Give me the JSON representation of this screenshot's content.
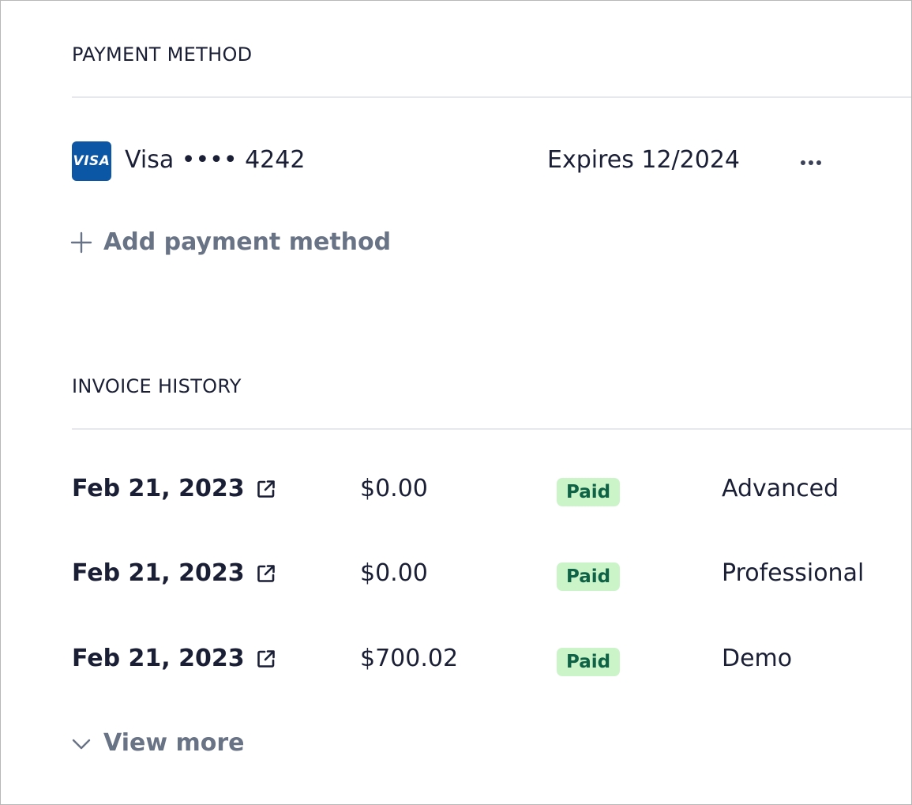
{
  "payment_method": {
    "title": "PAYMENT METHOD",
    "card": {
      "brand_logo_text": "VISA",
      "label": "Visa •••• 4242",
      "expiry": "Expires 12/2024",
      "brand_color": "#0b56a5"
    },
    "more_icon": "more-horizontal-icon",
    "add_label": "Add payment method",
    "add_icon": "plus-icon"
  },
  "invoice_history": {
    "title": "INVOICE HISTORY",
    "rows": [
      {
        "date": "Feb 21, 2023",
        "amount": "$0.00",
        "status": "Paid",
        "plan": "Advanced"
      },
      {
        "date": "Feb 21, 2023",
        "amount": "$0.00",
        "status": "Paid",
        "plan": "Professional"
      },
      {
        "date": "Feb 21, 2023",
        "amount": "$700.02",
        "status": "Paid",
        "plan": "Demo"
      }
    ],
    "link_icon": "external-link-icon",
    "view_more_label": "View more",
    "view_more_icon": "chevron-down-icon"
  },
  "colors": {
    "text_primary": "#1a1f36",
    "text_muted": "#697386",
    "divider": "#e6e8eb",
    "status_paid_bg": "#cbf4c9",
    "status_paid_text": "#0e6245"
  }
}
